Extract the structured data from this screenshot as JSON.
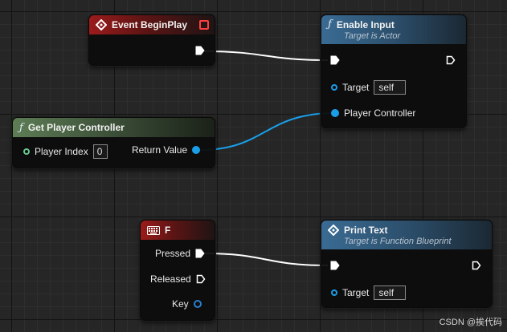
{
  "nodes": {
    "event_begin_play": {
      "title": "Event BeginPlay"
    },
    "enable_input": {
      "title": "Enable Input",
      "subtitle": "Target is Actor",
      "target_label": "Target",
      "target_value": "self",
      "player_controller_label": "Player Controller"
    },
    "get_player_controller": {
      "title": "Get Player Controller",
      "player_index_label": "Player Index",
      "player_index_value": "0",
      "return_value_label": "Return Value"
    },
    "key_f": {
      "title": "F",
      "pressed_label": "Pressed",
      "released_label": "Released",
      "key_label": "Key"
    },
    "print_text": {
      "title": "Print Text",
      "subtitle": "Target is Function Blueprint",
      "target_label": "Target",
      "target_value": "self"
    }
  },
  "icons": {
    "function": "function-icon",
    "event": "event-diamond-icon",
    "keyboard": "keyboard-icon"
  },
  "colors": {
    "event_header": "#9b1b1b",
    "function_header": "#3a6b93",
    "pure_header": "#5d7d55",
    "object_pin": "#1a9ee8",
    "exec_wire": "#ffffff"
  },
  "watermark": "CSDN @挨代码"
}
